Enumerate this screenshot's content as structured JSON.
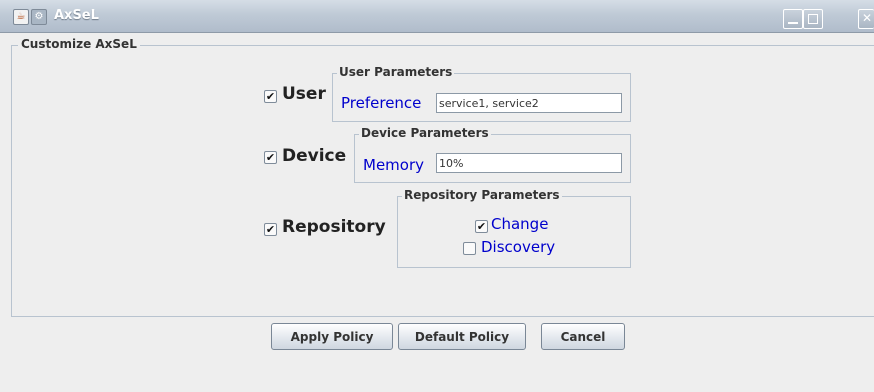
{
  "window": {
    "title": "AxSeL",
    "java_icon_glyph": "☕",
    "gear_icon_glyph": "⚙"
  },
  "panel": {
    "title": "Customize AxSeL"
  },
  "user": {
    "label": "User",
    "checked": true,
    "group_title": "User Parameters",
    "field_label": "Preference",
    "field_value": "service1, service2"
  },
  "device": {
    "label": "Device",
    "checked": true,
    "group_title": "Device Parameters",
    "field_label": "Memory",
    "field_value": "10%"
  },
  "repository": {
    "label": "Repository",
    "checked": true,
    "group_title": "Repository Parameters",
    "change_label": "Change",
    "change_checked": true,
    "discovery_label": "Discovery",
    "discovery_checked": false
  },
  "checkmark": "✔",
  "buttons": {
    "apply": "Apply Policy",
    "default": "Default Policy",
    "cancel": "Cancel"
  },
  "colors": {
    "label_blue": "#0000cc",
    "titlebar": "#bfcad6",
    "border": "#b8c3cf"
  }
}
